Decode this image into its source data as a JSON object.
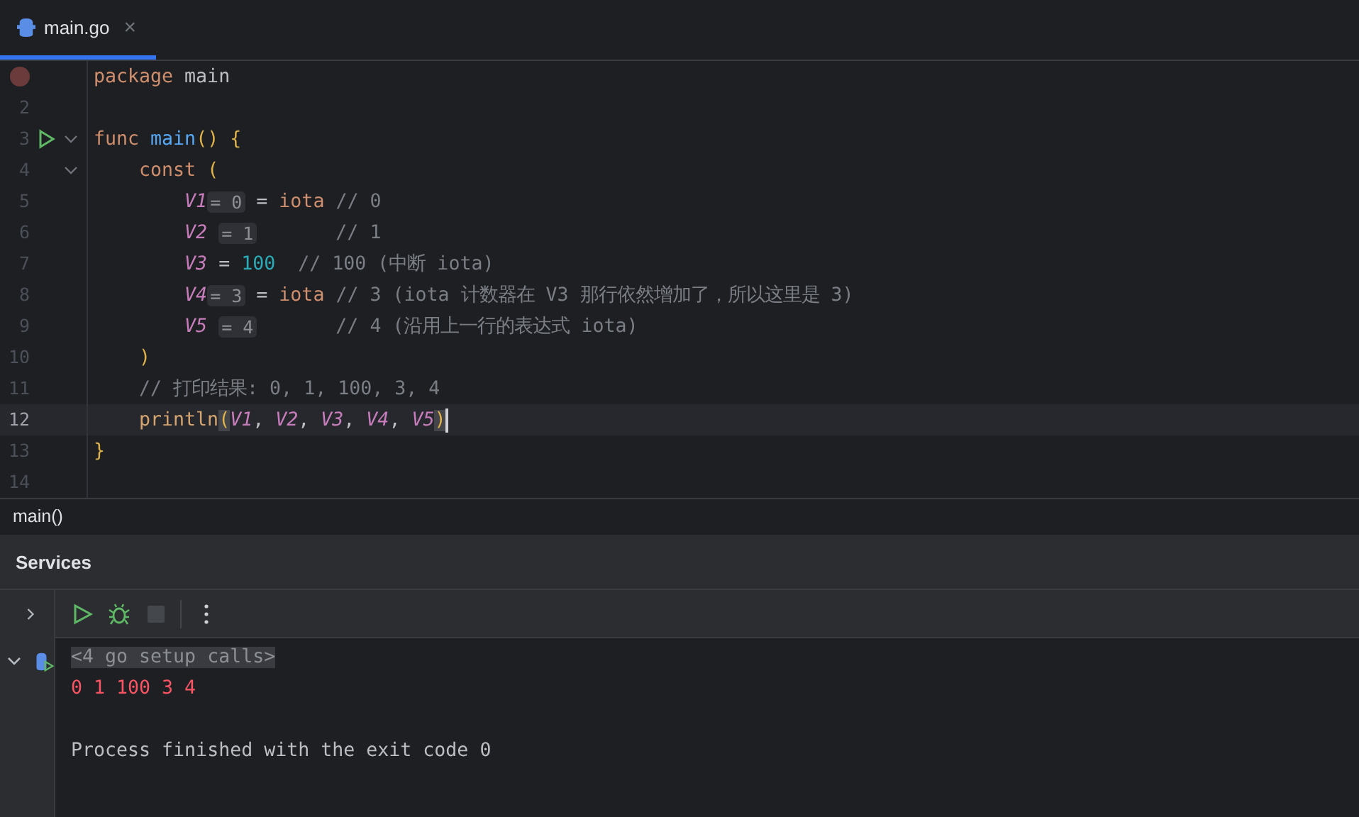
{
  "tabs": [
    {
      "label": "main.go",
      "close": "×",
      "selected": true
    }
  ],
  "editor": {
    "lines": [
      {
        "breakpoint": true,
        "run": false,
        "fold": false,
        "current": false,
        "caret": false,
        "tokens": [
          {
            "kind": "kw",
            "text": "package "
          },
          {
            "kind": "plain",
            "text": "main"
          }
        ]
      },
      {
        "number": "2",
        "breakpoint": false,
        "run": false,
        "fold": false,
        "current": false,
        "caret": false
      },
      {
        "number": "3",
        "breakpoint": false,
        "run": true,
        "fold": true,
        "current": false,
        "caret": false,
        "tokens": [
          {
            "kind": "kw",
            "text": "func "
          },
          {
            "kind": "fn",
            "text": "main"
          },
          {
            "kind": "brace",
            "text": "() {"
          }
        ]
      },
      {
        "number": "4",
        "breakpoint": false,
        "run": false,
        "fold": true,
        "current": false,
        "caret": false,
        "tokens": [
          {
            "kind": "kw",
            "text": "    const "
          },
          {
            "kind": "brace",
            "text": "("
          }
        ]
      },
      {
        "number": "5",
        "breakpoint": false,
        "run": false,
        "fold": false,
        "current": false,
        "caret": false,
        "tokens": [
          {
            "kind": "var",
            "text": "        V1"
          },
          {
            "kind": "hint",
            "text": "= 0"
          },
          {
            "kind": "plain",
            "text": " = "
          },
          {
            "kind": "kw",
            "text": "iota"
          },
          {
            "kind": "comment",
            "text": " // 0"
          }
        ]
      },
      {
        "number": "6",
        "breakpoint": false,
        "run": false,
        "fold": false,
        "current": false,
        "caret": false,
        "tokens": [
          {
            "kind": "var",
            "text": "        V2 "
          },
          {
            "kind": "hint",
            "text": "= 1"
          },
          {
            "kind": "comment",
            "text": "       // 1"
          }
        ]
      },
      {
        "number": "7",
        "breakpoint": false,
        "run": false,
        "fold": false,
        "current": false,
        "caret": false,
        "tokens": [
          {
            "kind": "var",
            "text": "        V3"
          },
          {
            "kind": "plain",
            "text": " = "
          },
          {
            "kind": "num",
            "text": "100"
          },
          {
            "kind": "comment",
            "text": "  // 100 (中断 iota)"
          }
        ]
      },
      {
        "number": "8",
        "breakpoint": false,
        "run": false,
        "fold": false,
        "current": false,
        "caret": false,
        "tokens": [
          {
            "kind": "var",
            "text": "        V4"
          },
          {
            "kind": "hint",
            "text": "= 3"
          },
          {
            "kind": "plain",
            "text": " = "
          },
          {
            "kind": "kw",
            "text": "iota"
          },
          {
            "kind": "comment",
            "text": " // 3 (iota 计数器在 V3 那行依然增加了，所以这里是 3)"
          }
        ]
      },
      {
        "number": "9",
        "breakpoint": false,
        "run": false,
        "fold": false,
        "current": false,
        "caret": false,
        "tokens": [
          {
            "kind": "var",
            "text": "        V5 "
          },
          {
            "kind": "hint",
            "text": "= 4"
          },
          {
            "kind": "comment",
            "text": "       // 4 (沿用上一行的表达式 iota)"
          }
        ]
      },
      {
        "number": "10",
        "breakpoint": false,
        "run": false,
        "fold": false,
        "current": false,
        "caret": false,
        "tokens": [
          {
            "kind": "brace",
            "text": "    )"
          }
        ]
      },
      {
        "number": "11",
        "breakpoint": false,
        "run": false,
        "fold": false,
        "current": false,
        "caret": false,
        "tokens": [
          {
            "kind": "comment",
            "text": "    // 打印结果: 0, 1, 100, 3, 4"
          }
        ]
      },
      {
        "number": "12",
        "breakpoint": false,
        "run": false,
        "fold": false,
        "current": true,
        "caret": true,
        "tokens": [
          {
            "kind": "call",
            "text": "    println"
          },
          {
            "kind": "match",
            "text": "("
          },
          {
            "kind": "var",
            "text": "V1"
          },
          {
            "kind": "plain",
            "text": ", "
          },
          {
            "kind": "var",
            "text": "V2"
          },
          {
            "kind": "plain",
            "text": ", "
          },
          {
            "kind": "var",
            "text": "V3"
          },
          {
            "kind": "plain",
            "text": ", "
          },
          {
            "kind": "var",
            "text": "V4"
          },
          {
            "kind": "plain",
            "text": ", "
          },
          {
            "kind": "var",
            "text": "V5"
          },
          {
            "kind": "match",
            "text": ")"
          }
        ]
      },
      {
        "number": "13",
        "breakpoint": false,
        "run": false,
        "fold": false,
        "current": false,
        "caret": false,
        "tokens": [
          {
            "kind": "brace",
            "text": "}"
          }
        ]
      },
      {
        "number": "14",
        "breakpoint": false,
        "run": false,
        "fold": false,
        "current": false,
        "caret": false
      }
    ]
  },
  "breadcrumb": "main()",
  "services": {
    "title": "Services",
    "toolbar": [
      {
        "kind": "run",
        "disabled": false
      },
      {
        "kind": "debug",
        "disabled": false
      },
      {
        "kind": "stop",
        "disabled": true
      },
      {
        "kind": "more",
        "disabled": false
      }
    ],
    "tree_expanded": true,
    "console": [
      {
        "kind": "folded",
        "text": "<4 go setup calls>"
      },
      {
        "kind": "output",
        "text": "0 1 100 3 4"
      },
      {
        "kind": "system",
        "text": "Process finished with the exit code 0"
      }
    ]
  }
}
